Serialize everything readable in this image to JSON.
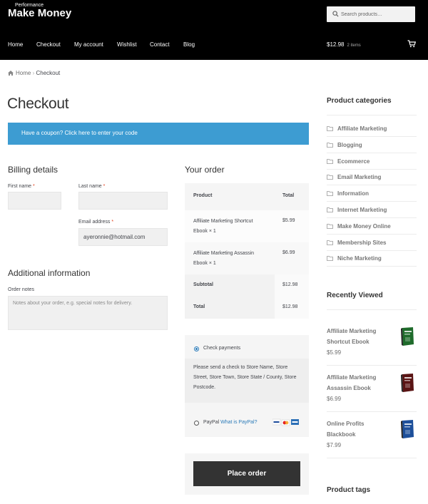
{
  "header": {
    "brand_small": "Performance",
    "brand": "Make Money",
    "search_placeholder": "Search products…",
    "nav": [
      "Home",
      "Checkout",
      "My account",
      "Wishlist",
      "Contact",
      "Blog"
    ],
    "cart_total": "$12.98",
    "cart_count": "2 items"
  },
  "breadcrumb": {
    "home": "Home",
    "sep": "›",
    "current": "Checkout"
  },
  "page_title": "Checkout",
  "coupon": "Have a coupon? Click here to enter your code",
  "billing": {
    "title": "Billing details",
    "first_name": "First name",
    "last_name": "Last name",
    "email_label": "Email address",
    "email_value": "ayeronnie@hotmail.com",
    "required": "*"
  },
  "additional": {
    "title": "Additional information",
    "notes_label": "Order notes",
    "notes_placeholder": "Notes about your order, e.g. special notes for delivery."
  },
  "order": {
    "title": "Your order",
    "col_product": "Product",
    "col_total": "Total",
    "items": [
      {
        "line1": "Affiliate Marketing Shortcut",
        "line2": "Ebook",
        "qty": "× 1",
        "price": "$5.99"
      },
      {
        "line1": "Affiliate Marketing Assassin",
        "line2": "Ebook",
        "qty": "× 1",
        "price": "$6.99"
      }
    ],
    "subtotal_label": "Subtotal",
    "subtotal": "$12.98",
    "total_label": "Total",
    "total": "$12.98"
  },
  "payment": {
    "check_label": "Check payments",
    "check_desc": "Please send a check to Store Name, Store Street, Store Town, Store State / County, Store Postcode.",
    "paypal_label": "PayPal",
    "paypal_link": "What is PayPal?",
    "place_order": "Place order"
  },
  "sidebar": {
    "categories_title": "Product categories",
    "categories": [
      "Affiliate Marketing",
      "Blogging",
      "Ecommerce",
      "Email Marketing",
      "Information",
      "Internet Marketing",
      "Make Money Online",
      "Membership Sites",
      "Niche Marketing"
    ],
    "recent_title": "Recently Viewed",
    "recent": [
      {
        "line1": "Affiliate Marketing",
        "line2": "Shortcut Ebook",
        "price": "$5.99",
        "color": "#1f6b2b"
      },
      {
        "line1": "Affiliate Marketing",
        "line2": "Assassin Ebook",
        "price": "$6.99",
        "color": "#5a1414"
      },
      {
        "line1": "Online Profits",
        "line2": "Blackbook",
        "price": "$7.99",
        "color": "#1d4f9a"
      }
    ],
    "tags_title": "Product tags"
  },
  "colors": {
    "accent": "#3d9cd2",
    "header_bg": "#000000",
    "button_bg": "#333333",
    "required": "#e2401c",
    "link": "#2a7ab8"
  }
}
